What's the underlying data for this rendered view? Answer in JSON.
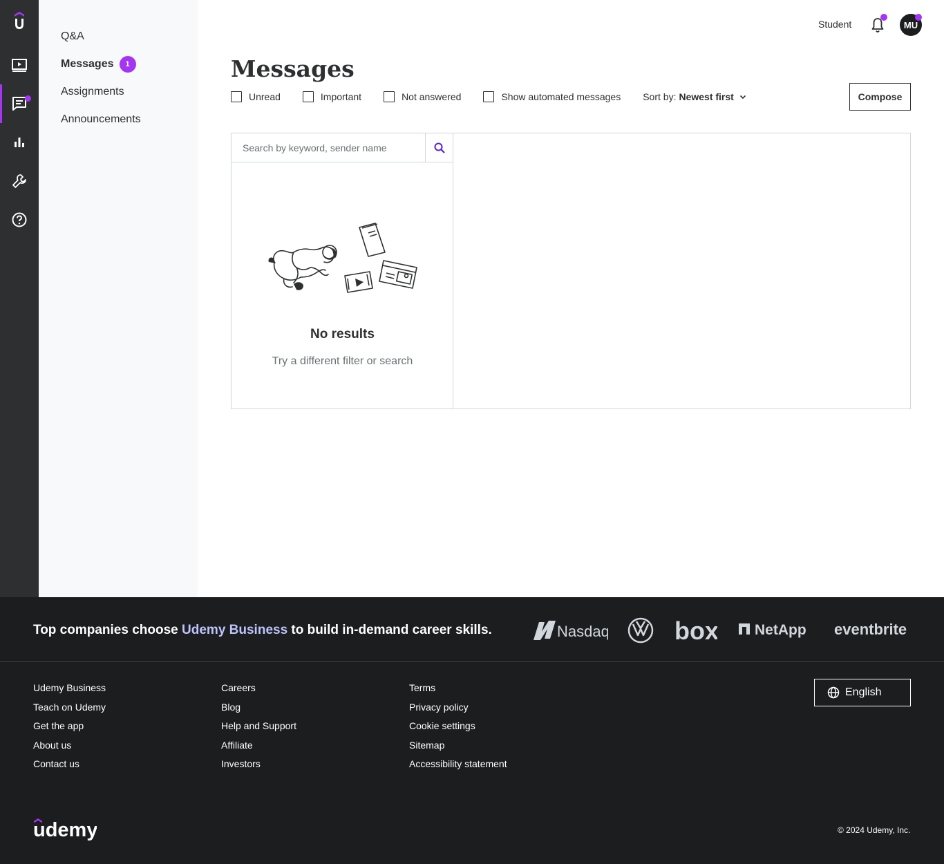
{
  "sidebar_nav": {
    "items": [
      {
        "label": "Q&A",
        "active": false
      },
      {
        "label": "Messages",
        "active": true,
        "badge": "1"
      },
      {
        "label": "Assignments",
        "active": false
      },
      {
        "label": "Announcements",
        "active": false
      }
    ]
  },
  "rail": {
    "icons": [
      "udemy-logo-icon",
      "courses-icon",
      "communication-icon",
      "performance-icon",
      "tools-icon",
      "help-icon"
    ],
    "active": "communication-icon"
  },
  "header": {
    "student_link": "Student",
    "avatar_initials": "MU"
  },
  "page": {
    "title": "Messages",
    "filters": [
      {
        "label": "Unread",
        "checked": false
      },
      {
        "label": "Important",
        "checked": false
      },
      {
        "label": "Not answered",
        "checked": false
      },
      {
        "label": "Show automated messages",
        "checked": false
      }
    ],
    "sort_prefix": "Sort by:",
    "sort_value": "Newest first",
    "compose_label": "Compose",
    "search_placeholder": "Search by keyword, sender name",
    "empty_title": "No results",
    "empty_subtitle": "Try a different filter or search"
  },
  "footer": {
    "tagline_before": "Top companies choose ",
    "tagline_highlight": "Udemy Business",
    "tagline_after": " to build in-demand career skills.",
    "partner_logos": [
      "Nasdaq",
      "Volkswagen",
      "box",
      "NetApp",
      "eventbrite"
    ],
    "columns": [
      [
        "Udemy Business",
        "Teach on Udemy",
        "Get the app",
        "About us",
        "Contact us"
      ],
      [
        "Careers",
        "Blog",
        "Help and Support",
        "Affiliate",
        "Investors"
      ],
      [
        "Terms",
        "Privacy policy",
        "Cookie settings",
        "Sitemap",
        "Accessibility statement"
      ]
    ],
    "language": "English",
    "logo_text": "udemy",
    "copyright": "© 2024 Udemy, Inc."
  },
  "colors": {
    "accent": "#a435f0",
    "rail_bg": "#2d2f31",
    "footer_bg": "#1c1d1f",
    "highlight": "#c0c4fc"
  }
}
